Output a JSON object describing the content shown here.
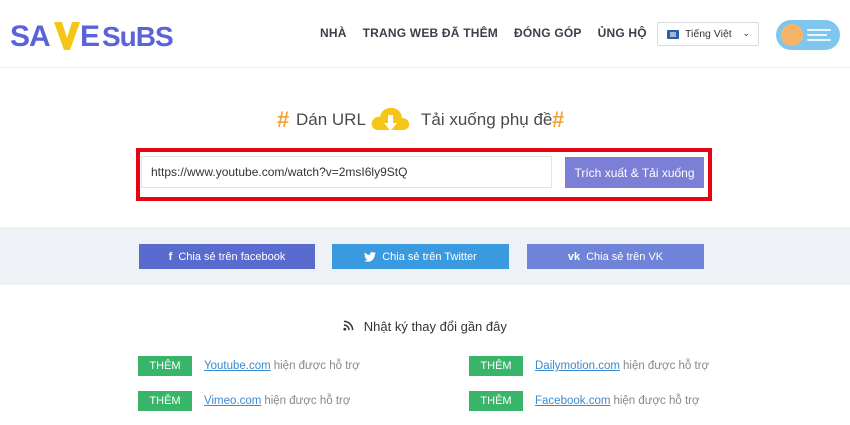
{
  "header": {
    "logo_text": "SAVESUBS",
    "nav": [
      "NHÀ",
      "TRANG WEB ĐÃ THÊM",
      "ĐÓNG GÓP",
      "ỦNG HỘ"
    ],
    "language": "Tiếng Việt",
    "theme_toggle": "toggle-icon"
  },
  "hero": {
    "hash": "#",
    "paste_label": "Dán URL",
    "download_label": "Tải xuống phụ đề",
    "icon": "cloud-download-icon",
    "url_value": "https://www.youtube.com/watch?v=2msI6ly9StQ",
    "button_label": "Trích xuất & Tải xuống",
    "highlight_color": "#e30613"
  },
  "share": {
    "facebook": "Chia sẻ trên facebook",
    "twitter": "Chia sẻ trên Twitter",
    "vk": "Chia sẻ trên VK",
    "icons": {
      "facebook": "f",
      "twitter": "twitter-icon",
      "vk": "vk-icon"
    }
  },
  "changelog": {
    "title": "Nhật ký thay đổi gần đây",
    "icon": "rss-icon",
    "items": [
      {
        "badge": "THÊM",
        "site": "Youtube.com",
        "text": "hiện được hỗ trợ"
      },
      {
        "badge": "THÊM",
        "site": "Dailymotion.com",
        "text": "hiện được hỗ trợ"
      },
      {
        "badge": "THÊM",
        "site": "Vimeo.com",
        "text": "hiện được hỗ trợ"
      },
      {
        "badge": "THÊM",
        "site": "Facebook.com",
        "text": "hiện được hỗ trợ"
      }
    ]
  },
  "colors": {
    "brand_blue": "#5a63d8",
    "brand_yellow": "#f5c518",
    "add_badge": "#39b56a",
    "extract_button": "#7b80d6"
  }
}
